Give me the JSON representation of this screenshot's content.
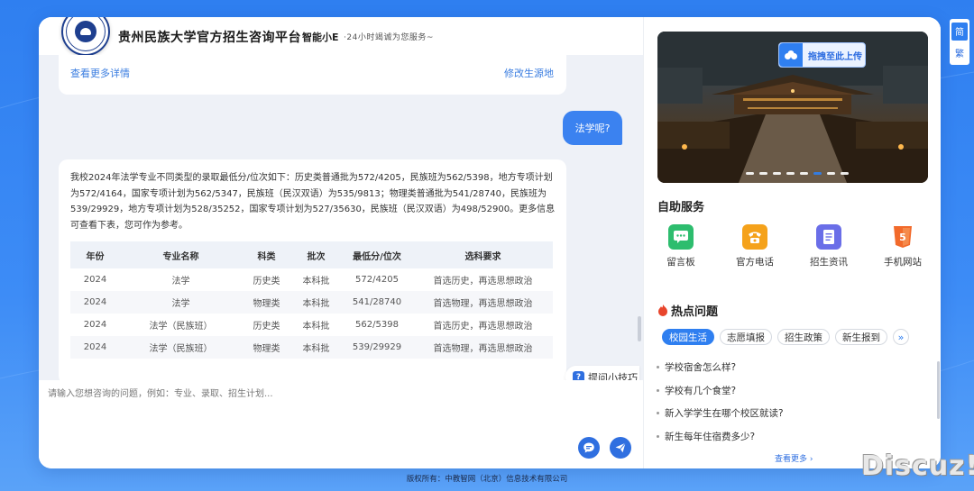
{
  "header": {
    "title": "贵州民族大学官方招生咨询平台",
    "assistant_name": "智能小E",
    "slogan": "·24小时竭诚为您服务~"
  },
  "chat": {
    "prev_message": {
      "details_link": "查看更多详情",
      "change_origin_link": "修改生源地"
    },
    "user_message": "法学呢?",
    "bot_message": {
      "text": "我校2024年法学专业不同类型的录取最低分/位次如下：历史类普通批为572/4205，民族班为562/5398，地方专项计划为572/4164，国家专项计划为562/5347，民族班（民汉双语）为535/9813；物理类普通批为541/28740，民族班为539/29929，地方专项计划为528/35252，国家专项计划为527/35630，民族班（民汉双语）为498/52900。更多信息可查看下表，您可作为参考。",
      "table": {
        "headers": [
          "年份",
          "专业名称",
          "科类",
          "批次",
          "最低分/位次",
          "选科要求"
        ],
        "rows": [
          [
            "2024",
            "法学",
            "历史类",
            "本科批",
            "572/4205",
            "首选历史，再选思想政治"
          ],
          [
            "2024",
            "法学",
            "物理类",
            "本科批",
            "541/28740",
            "首选物理，再选思想政治"
          ],
          [
            "2024",
            "法学（民族班）",
            "历史类",
            "本科批",
            "562/5398",
            "首选历史，再选思想政治"
          ],
          [
            "2024",
            "法学（民族班）",
            "物理类",
            "本科批",
            "539/29929",
            "首选物理，再选思想政治"
          ]
        ]
      }
    },
    "tips_label": "提问小技巧",
    "input_placeholder": "请输入您想咨询的问题，例如：专业、录取、招生计划..."
  },
  "banner": {
    "upload_label": "拖拽至此上传",
    "slides_total": 8,
    "active_slide": 6
  },
  "self_service": {
    "title": "自助服务",
    "items": [
      {
        "label": "留言板",
        "icon": "message-board-icon",
        "color": "#2dbd6e"
      },
      {
        "label": "官方电话",
        "icon": "phone-icon",
        "color": "#f5a21b"
      },
      {
        "label": "招生资讯",
        "icon": "news-icon",
        "color": "#6a6ee8"
      },
      {
        "label": "手机网站",
        "icon": "html5-icon",
        "color": "#f26a2b"
      }
    ]
  },
  "hot_questions": {
    "title": "热点问题",
    "tabs": [
      "校园生活",
      "志愿填报",
      "招生政策",
      "新生报到"
    ],
    "active_tab": 0,
    "questions": [
      "学校宿舍怎么样?",
      "学校有几个食堂?",
      "新入学学生在哪个校区就读?",
      "新生每年住宿费多少?"
    ],
    "see_more": "查看更多"
  },
  "language": {
    "simplified": "简",
    "traditional": "繁"
  },
  "footer": "版权所有：中教智网（北京）信息技术有限公司",
  "watermark": "Discuz!",
  "colors": {
    "primary": "#2f7ff0",
    "background": "#3d8cf6"
  }
}
